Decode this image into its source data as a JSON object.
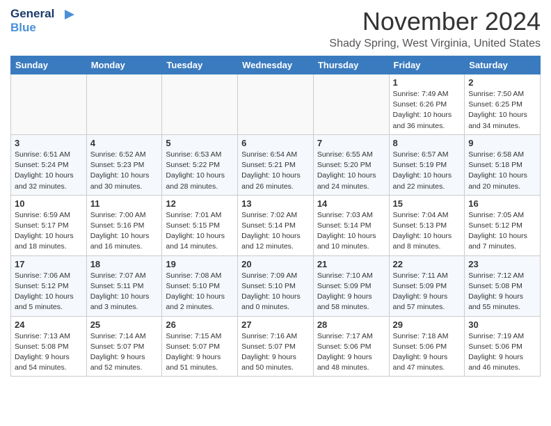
{
  "header": {
    "logo_line1": "General",
    "logo_line2": "Blue",
    "month": "November 2024",
    "location": "Shady Spring, West Virginia, United States"
  },
  "weekdays": [
    "Sunday",
    "Monday",
    "Tuesday",
    "Wednesday",
    "Thursday",
    "Friday",
    "Saturday"
  ],
  "weeks": [
    [
      {
        "day": "",
        "info": ""
      },
      {
        "day": "",
        "info": ""
      },
      {
        "day": "",
        "info": ""
      },
      {
        "day": "",
        "info": ""
      },
      {
        "day": "",
        "info": ""
      },
      {
        "day": "1",
        "info": "Sunrise: 7:49 AM\nSunset: 6:26 PM\nDaylight: 10 hours\nand 36 minutes."
      },
      {
        "day": "2",
        "info": "Sunrise: 7:50 AM\nSunset: 6:25 PM\nDaylight: 10 hours\nand 34 minutes."
      }
    ],
    [
      {
        "day": "3",
        "info": "Sunrise: 6:51 AM\nSunset: 5:24 PM\nDaylight: 10 hours\nand 32 minutes."
      },
      {
        "day": "4",
        "info": "Sunrise: 6:52 AM\nSunset: 5:23 PM\nDaylight: 10 hours\nand 30 minutes."
      },
      {
        "day": "5",
        "info": "Sunrise: 6:53 AM\nSunset: 5:22 PM\nDaylight: 10 hours\nand 28 minutes."
      },
      {
        "day": "6",
        "info": "Sunrise: 6:54 AM\nSunset: 5:21 PM\nDaylight: 10 hours\nand 26 minutes."
      },
      {
        "day": "7",
        "info": "Sunrise: 6:55 AM\nSunset: 5:20 PM\nDaylight: 10 hours\nand 24 minutes."
      },
      {
        "day": "8",
        "info": "Sunrise: 6:57 AM\nSunset: 5:19 PM\nDaylight: 10 hours\nand 22 minutes."
      },
      {
        "day": "9",
        "info": "Sunrise: 6:58 AM\nSunset: 5:18 PM\nDaylight: 10 hours\nand 20 minutes."
      }
    ],
    [
      {
        "day": "10",
        "info": "Sunrise: 6:59 AM\nSunset: 5:17 PM\nDaylight: 10 hours\nand 18 minutes."
      },
      {
        "day": "11",
        "info": "Sunrise: 7:00 AM\nSunset: 5:16 PM\nDaylight: 10 hours\nand 16 minutes."
      },
      {
        "day": "12",
        "info": "Sunrise: 7:01 AM\nSunset: 5:15 PM\nDaylight: 10 hours\nand 14 minutes."
      },
      {
        "day": "13",
        "info": "Sunrise: 7:02 AM\nSunset: 5:14 PM\nDaylight: 10 hours\nand 12 minutes."
      },
      {
        "day": "14",
        "info": "Sunrise: 7:03 AM\nSunset: 5:14 PM\nDaylight: 10 hours\nand 10 minutes."
      },
      {
        "day": "15",
        "info": "Sunrise: 7:04 AM\nSunset: 5:13 PM\nDaylight: 10 hours\nand 8 minutes."
      },
      {
        "day": "16",
        "info": "Sunrise: 7:05 AM\nSunset: 5:12 PM\nDaylight: 10 hours\nand 7 minutes."
      }
    ],
    [
      {
        "day": "17",
        "info": "Sunrise: 7:06 AM\nSunset: 5:12 PM\nDaylight: 10 hours\nand 5 minutes."
      },
      {
        "day": "18",
        "info": "Sunrise: 7:07 AM\nSunset: 5:11 PM\nDaylight: 10 hours\nand 3 minutes."
      },
      {
        "day": "19",
        "info": "Sunrise: 7:08 AM\nSunset: 5:10 PM\nDaylight: 10 hours\nand 2 minutes."
      },
      {
        "day": "20",
        "info": "Sunrise: 7:09 AM\nSunset: 5:10 PM\nDaylight: 10 hours\nand 0 minutes."
      },
      {
        "day": "21",
        "info": "Sunrise: 7:10 AM\nSunset: 5:09 PM\nDaylight: 9 hours\nand 58 minutes."
      },
      {
        "day": "22",
        "info": "Sunrise: 7:11 AM\nSunset: 5:09 PM\nDaylight: 9 hours\nand 57 minutes."
      },
      {
        "day": "23",
        "info": "Sunrise: 7:12 AM\nSunset: 5:08 PM\nDaylight: 9 hours\nand 55 minutes."
      }
    ],
    [
      {
        "day": "24",
        "info": "Sunrise: 7:13 AM\nSunset: 5:08 PM\nDaylight: 9 hours\nand 54 minutes."
      },
      {
        "day": "25",
        "info": "Sunrise: 7:14 AM\nSunset: 5:07 PM\nDaylight: 9 hours\nand 52 minutes."
      },
      {
        "day": "26",
        "info": "Sunrise: 7:15 AM\nSunset: 5:07 PM\nDaylight: 9 hours\nand 51 minutes."
      },
      {
        "day": "27",
        "info": "Sunrise: 7:16 AM\nSunset: 5:07 PM\nDaylight: 9 hours\nand 50 minutes."
      },
      {
        "day": "28",
        "info": "Sunrise: 7:17 AM\nSunset: 5:06 PM\nDaylight: 9 hours\nand 48 minutes."
      },
      {
        "day": "29",
        "info": "Sunrise: 7:18 AM\nSunset: 5:06 PM\nDaylight: 9 hours\nand 47 minutes."
      },
      {
        "day": "30",
        "info": "Sunrise: 7:19 AM\nSunset: 5:06 PM\nDaylight: 9 hours\nand 46 minutes."
      }
    ]
  ]
}
